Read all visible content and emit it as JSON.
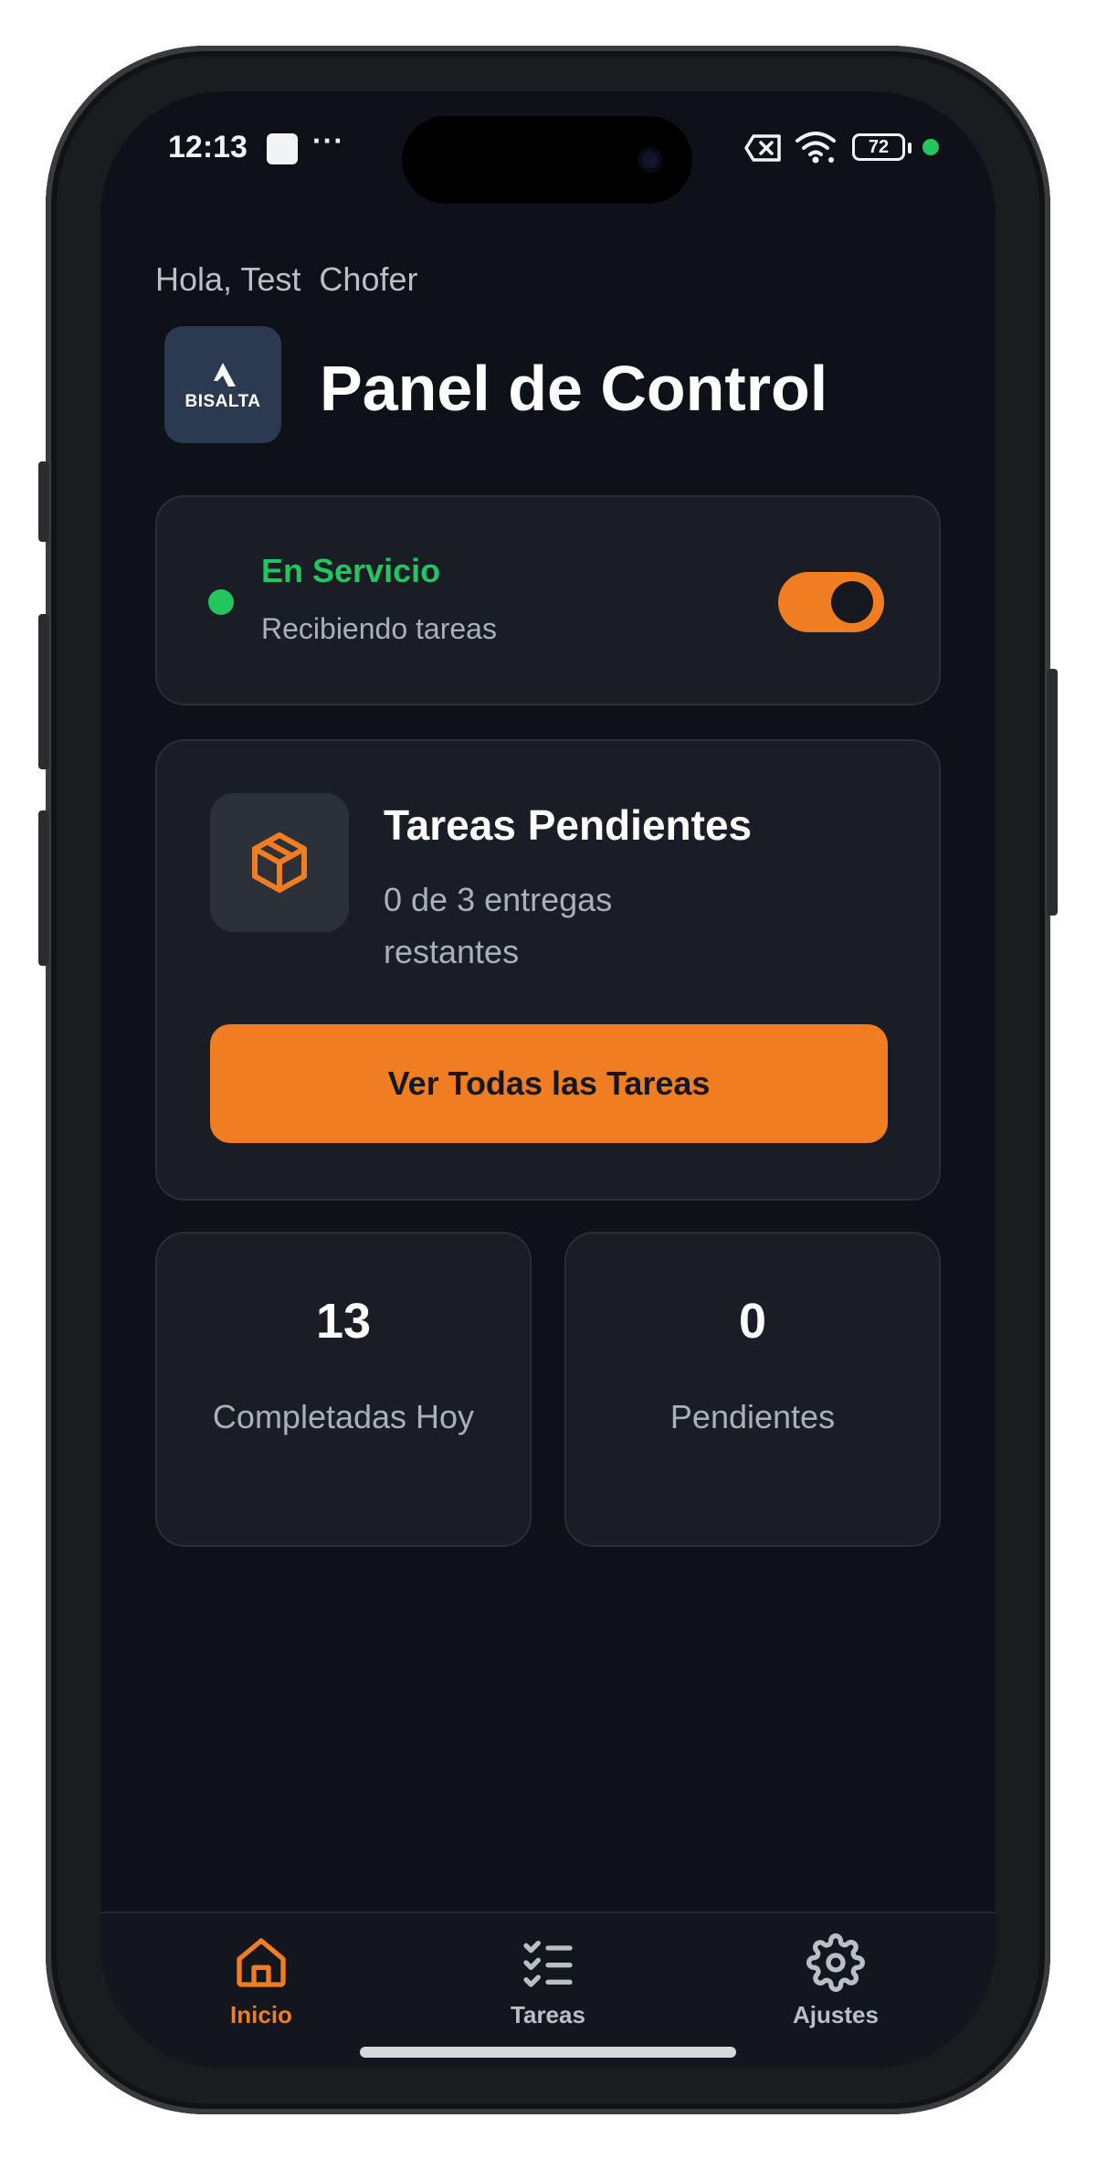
{
  "status_bar": {
    "time": "12:13",
    "dots": "···",
    "battery": "72",
    "icons": [
      "notification-square-icon",
      "sim-x-icon",
      "wifi-icon",
      "battery-icon",
      "active-indicator-dot"
    ]
  },
  "header": {
    "greeting": "Hola, Test  Chofer",
    "logo_text": "BISALTA",
    "title": "Panel de Control"
  },
  "service": {
    "title": "En Servicio",
    "subtitle": "Recibiendo tareas",
    "toggle_on": true
  },
  "tasks": {
    "title": "Tareas Pendientes",
    "subtitle": "0 de 3 entregas restantes",
    "button_label": "Ver Todas las Tareas",
    "icon": "package-icon"
  },
  "stats": [
    {
      "value": "13",
      "label": "Completadas Hoy"
    },
    {
      "value": "0",
      "label": "Pendientes"
    }
  ],
  "tab_bar": {
    "items": [
      {
        "label": "Inicio",
        "icon": "home-icon",
        "active": true
      },
      {
        "label": "Tareas",
        "icon": "checklist-icon",
        "active": false
      },
      {
        "label": "Ajustes",
        "icon": "gear-icon",
        "active": false
      }
    ]
  },
  "colors": {
    "accent": "#f07d22",
    "success": "#22c55e",
    "background": "#0e1118",
    "card": "#1a1d25"
  }
}
